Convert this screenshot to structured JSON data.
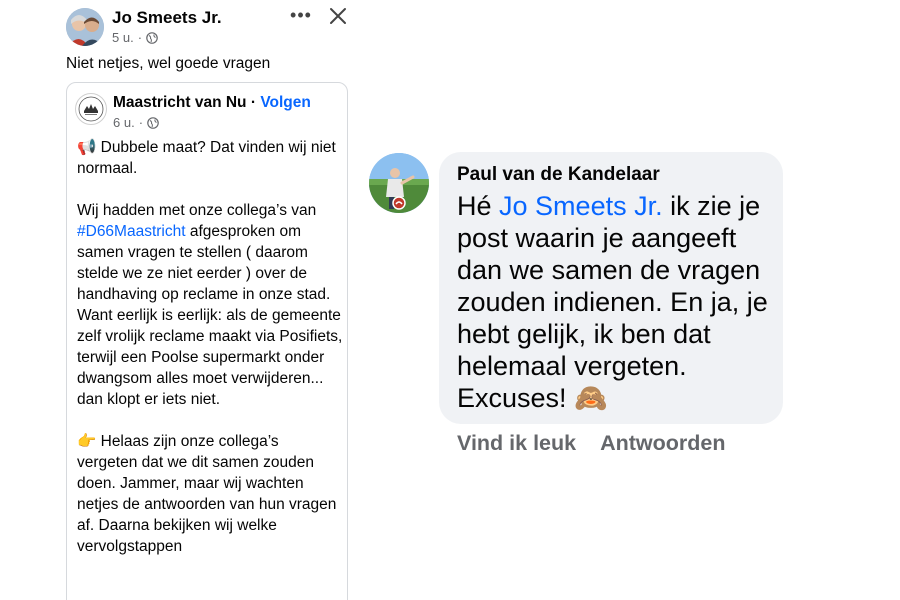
{
  "post": {
    "author": "Jo Smeets Jr.",
    "time": "5 u.",
    "dot": "·",
    "text": "Niet netjes, wel goede vragen",
    "icons": {
      "more": "more-options-icon",
      "close": "close-icon",
      "audience": "globe-icon"
    }
  },
  "shared": {
    "page_name": "Maastricht van Nu",
    "separator": "·",
    "follow_label": "Volgen",
    "time": "6 u.",
    "dot": "·",
    "body": {
      "megaphone": "📢",
      "p1": " Dubbele maat? Dat vinden wij niet normaal.",
      "p2_before": "Wij hadden met onze collega’s van ",
      "hashtag": "#D66Maastricht",
      "p2_after": " afgesproken om samen vragen te stellen ( daarom stelde we ze niet eerder ) over de handhaving op reclame in onze stad. Want eerlijk is eerlijk: als de gemeente zelf vrolijk reclame maakt via Posifiets, terwijl een Poolse supermarkt onder dwangsom alles moet verwijderen... dan klopt er iets niet.",
      "pointing": "👉",
      "p3": " Helaas zijn onze collega’s vergeten dat we dit samen zouden doen. Jammer, maar wij wachten netjes de antwoorden van hun vragen af. Daarna bekijken wij welke vervolgstappen"
    }
  },
  "comment": {
    "author": "Paul van de Kandelaar",
    "greeting": "Hé ",
    "mention": "Jo Smeets Jr.",
    "text": " ik zie je post waarin je aangeeft dan we samen de vragen zouden indienen. En ja, je hebt gelijk, ik ben dat helemaal vergeten. Excuses! ",
    "emoji": "🙈",
    "like_label": "Vind ik leuk",
    "reply_label": "Antwoorden"
  },
  "colors": {
    "link_blue": "#0866ff",
    "meta_gray": "#65676b",
    "bubble_bg": "#f0f2f5"
  }
}
